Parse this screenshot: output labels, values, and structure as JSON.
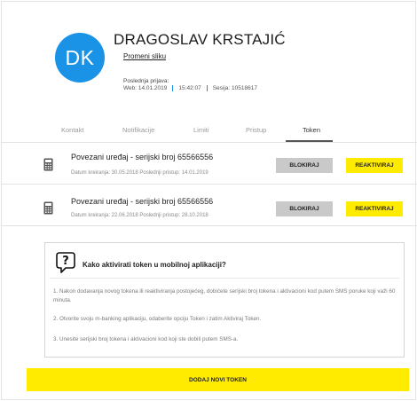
{
  "profile": {
    "initials": "DK",
    "name": "DRAGOSLAV  KRSTAJIĆ",
    "change_photo": "Promeni sliku",
    "last_login_title": "Poslednja prijava:",
    "last_login_web": "Web:  14.01.2019",
    "last_login_time": "15:42:07",
    "session": "Sesija:  10518617"
  },
  "tabs": [
    {
      "label": "Kontakt"
    },
    {
      "label": "Notifikacije"
    },
    {
      "label": "Limiti"
    },
    {
      "label": "Pristup"
    },
    {
      "label": "Token",
      "active": true
    }
  ],
  "tokens": [
    {
      "title": "Povezani uređaj - serijski broj  65566556",
      "meta": "Datum kreiranja: 30.05.2018 Poslednji pristup: 14.01.2019",
      "block_label": "BLOKIRAJ",
      "reactivate_label": "REAKTIVIRAJ",
      "icon": "calculator-icon"
    },
    {
      "title": "Povezani uređaj - serijski broj  65566556",
      "meta": "Datum kreiranja: 22.06.2018 Poslednji pristup: 28.10.2018",
      "block_label": "BLOKIRAJ",
      "reactivate_label": "REAKTIVIRAJ",
      "icon": "calculator-icon"
    }
  ],
  "info": {
    "icon": "question-bubble-icon",
    "title": "Kako aktivirati token u mobilnoj aplikaciji?",
    "steps": [
      "1. Nakon dodavanja novog tokena ili reaktiviranja postojećeg, dobićete serijski broj tokena i aktivacioni kod putem SMS poruke koji važi 60 minuta.",
      "2. Otvorite svoju m-banking aplikaciju, odaberite opciju Token i zatim Aktiviraj Token.",
      "3. Unesite serijski broj tokena i aktivacioni kod koji ste dobili putem SMS-a."
    ]
  },
  "add_button": "DODAJ NOVI TOKEN",
  "colors": {
    "accent_blue": "#1a93e6",
    "yellow": "#ffeb00",
    "gray_button": "#c9c9c9"
  }
}
